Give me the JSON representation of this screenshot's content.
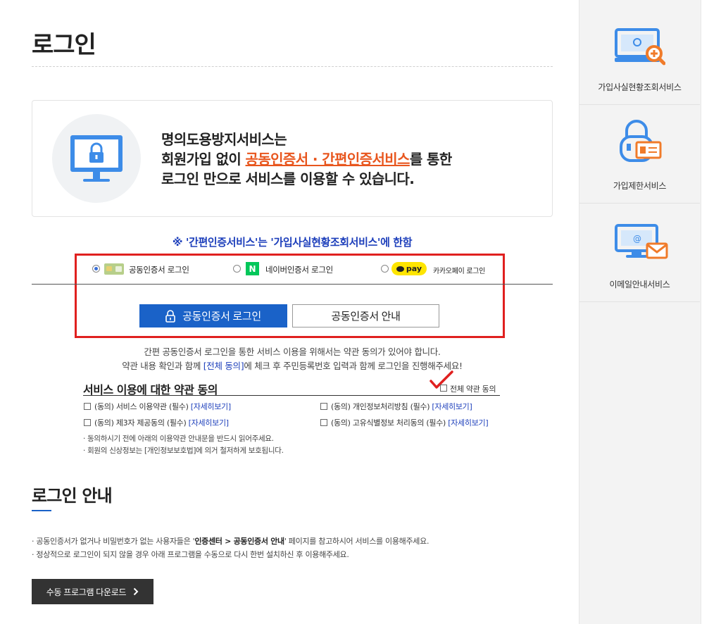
{
  "page": {
    "title": "로그인"
  },
  "intro": {
    "line1": "명의도용방지서비스는",
    "line2_pre": "회원가입 없이 ",
    "line2_highlight": "공동인증서 · 간편인증서비스",
    "line2_post": "를 통한",
    "line3": "로그인 만으로 서비스를 이용할 수 있습니다."
  },
  "notice": "※ '간편인증서비스'는 '가입사실현황조회서비스'에 한함",
  "login_options": [
    {
      "label": "공동인증서 로그인",
      "selected": true
    },
    {
      "label": "네이버인증서 로그인",
      "badge": "N",
      "selected": false
    },
    {
      "label": "카카오페이 로그인",
      "badge": "pay",
      "selected": false
    }
  ],
  "buttons": {
    "cert_login": "공동인증서 로그인",
    "cert_guide": "공동인증서 안내"
  },
  "guide": {
    "line1": "간편 공동인증서 로그인을 통한 서비스 이용을 위해서는 약관 동의가 있어야 합니다.",
    "line2_pre": "약관 내용 확인과 함께 ",
    "line2_link": "[전체 동의]",
    "line2_post": "에 체크 후 주민등록번호 입력과 함께 로그인을 진행해주세요!"
  },
  "terms": {
    "title": "서비스 이용에 대한 약관 동의",
    "agree_all": "전체 약관 동의",
    "items": [
      {
        "text": "(동의) 서비스 이용약관 (필수)",
        "link": "[자세히보기]"
      },
      {
        "text": "(동의) 개인정보처리방침 (필수)",
        "link": "[자세히보기]"
      },
      {
        "text": "(동의) 제3자 제공동의 (필수)",
        "link": "[자세히보기]"
      },
      {
        "text": "(동의) 고유식별정보 처리동의 (필수)",
        "link": "[자세히보기]"
      }
    ],
    "notes": [
      "· 동의하시기 전에 아래의 이용약관 안내문을 반드시 읽어주세요.",
      "· 회원의 신상정보는 [개인정보보호법]에 의거 철저하게 보호됩니다."
    ]
  },
  "login_guide": {
    "title": "로그인 안내",
    "bullet1_pre": "· 공동인증서가 없거나 비밀번호가 없는 사용자들은 '",
    "bullet1_bold": "인증센터 > 공동인증서 안내",
    "bullet1_post": "' 페이지를 참고하시어 서비스를 이용해주세요.",
    "bullet2": "· 정상적으로 로그인이 되지 않을 경우 아래 프로그램을 수동으로 다시 한번 설치하신 후 이용해주세요.",
    "download_button": "수동 프로그램 다운로드"
  },
  "sidebar": {
    "items": [
      {
        "label": "가입사실현황조회서비스",
        "icon": "monitor-search-icon"
      },
      {
        "label": "가입제한서비스",
        "icon": "lock-card-icon"
      },
      {
        "label": "이메일안내서비스",
        "icon": "monitor-email-icon"
      }
    ]
  },
  "colors": {
    "accent_blue": "#1a62c8",
    "highlight_orange": "#e8561e",
    "red_box": "#e0201f",
    "notice_blue": "#1d3fbb",
    "naver_green": "#03c75a",
    "kakao_yellow": "#fee500"
  }
}
